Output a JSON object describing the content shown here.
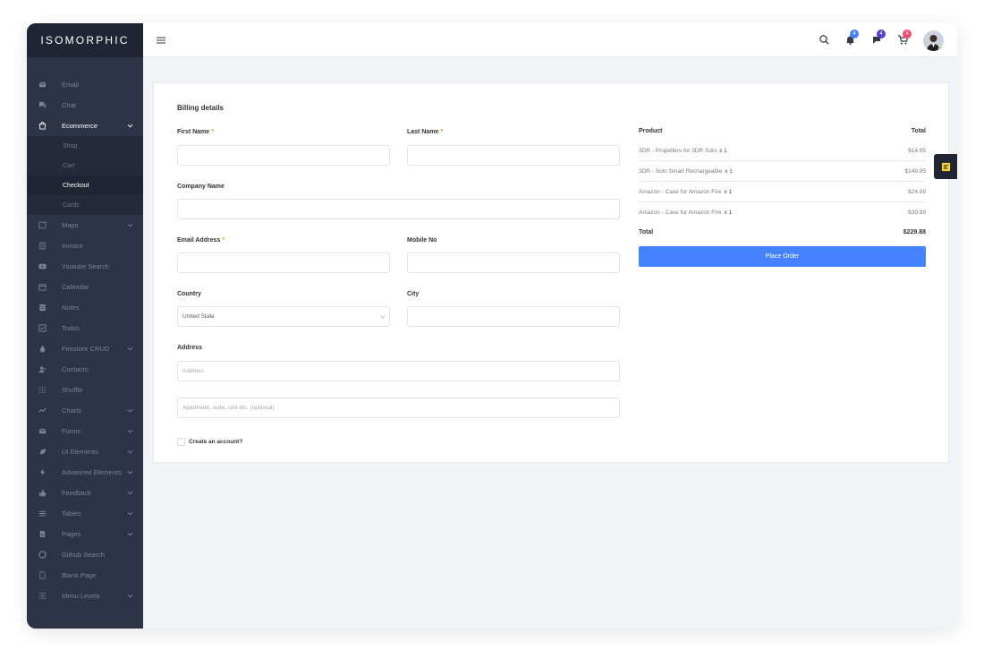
{
  "app": {
    "logo": "ISOMORPHIC",
    "accent_color": "#4482ff",
    "sidebar_color": "#2d3446"
  },
  "sidebar": {
    "items": [
      {
        "label": "Email",
        "icon": "mail-icon",
        "has_submenu": false
      },
      {
        "label": "Chat",
        "icon": "chat-icon",
        "has_submenu": false
      },
      {
        "label": "Ecommerce",
        "icon": "shopping-bag-icon",
        "has_submenu": true,
        "open": true,
        "children": [
          {
            "label": "Shop"
          },
          {
            "label": "Cart"
          },
          {
            "label": "Checkout",
            "active": true
          },
          {
            "label": "Cards"
          }
        ]
      },
      {
        "label": "Maps",
        "icon": "map-icon",
        "has_submenu": true
      },
      {
        "label": "Invoice",
        "icon": "invoice-icon",
        "has_submenu": false
      },
      {
        "label": "Youtube Search",
        "icon": "youtube-icon",
        "has_submenu": false
      },
      {
        "label": "Calendar",
        "icon": "calendar-icon",
        "has_submenu": false
      },
      {
        "label": "Notes",
        "icon": "notes-icon",
        "has_submenu": false
      },
      {
        "label": "Todos",
        "icon": "todo-icon",
        "has_submenu": false
      },
      {
        "label": "Firestore CRUD",
        "icon": "fire-icon",
        "has_submenu": true
      },
      {
        "label": "Contacts",
        "icon": "contacts-icon",
        "has_submenu": false
      },
      {
        "label": "Shuffle",
        "icon": "shuffle-icon",
        "has_submenu": false
      },
      {
        "label": "Charts",
        "icon": "chart-icon",
        "has_submenu": true
      },
      {
        "label": "Forms",
        "icon": "forms-icon",
        "has_submenu": true
      },
      {
        "label": "UI Elements",
        "icon": "leaf-icon",
        "has_submenu": true
      },
      {
        "label": "Advanced Elements",
        "icon": "bolt-icon",
        "has_submenu": true
      },
      {
        "label": "Feedback",
        "icon": "thumbs-up-icon",
        "has_submenu": true
      },
      {
        "label": "Tables",
        "icon": "table-icon",
        "has_submenu": true
      },
      {
        "label": "Pages",
        "icon": "pages-icon",
        "has_submenu": true
      },
      {
        "label": "Github Search",
        "icon": "github-icon",
        "has_submenu": false
      },
      {
        "label": "Blank Page",
        "icon": "blank-page-icon",
        "has_submenu": false
      },
      {
        "label": "Menu Levels",
        "icon": "levels-icon",
        "has_submenu": true
      }
    ]
  },
  "topbar": {
    "notifications": [
      {
        "icon": "bell-icon",
        "count": "4",
        "color": "#4482ff"
      },
      {
        "icon": "message-icon",
        "count": "4",
        "color": "#5a3ec8"
      },
      {
        "icon": "cart-icon",
        "count": "4",
        "color": "#f64870"
      }
    ]
  },
  "form": {
    "title": "Billing details",
    "first_name_label": "First Name",
    "last_name_label": "Last Name",
    "company_label": "Company Name",
    "email_label": "Email Address",
    "mobile_label": "Mobile No",
    "country_label": "Country",
    "country_value": "United State",
    "city_label": "City",
    "address_label": "Address",
    "address_placeholder": "Address",
    "apartment_placeholder": "Apartment, suite, unit etc. (optional)",
    "create_account_label": "Create an account?",
    "required_mark": "*"
  },
  "order": {
    "product_header": "Product",
    "total_header": "Total",
    "items": [
      {
        "name": "3DR - Propellers for 3DR Solo",
        "qty": "x 1",
        "price": "$14.95"
      },
      {
        "name": "3DR - Solo Smart Rechargeable",
        "qty": "x 1",
        "price": "$149.95"
      },
      {
        "name": "Amazon - Case for Amazon Fire",
        "qty": "x 1",
        "price": "$24.99"
      },
      {
        "name": "Amazon - Case for Amazon Fire",
        "qty": "x 1",
        "price": "$39.99"
      }
    ],
    "total_label": "Total",
    "total_value": "$229.88",
    "place_order_label": "Place Order"
  }
}
